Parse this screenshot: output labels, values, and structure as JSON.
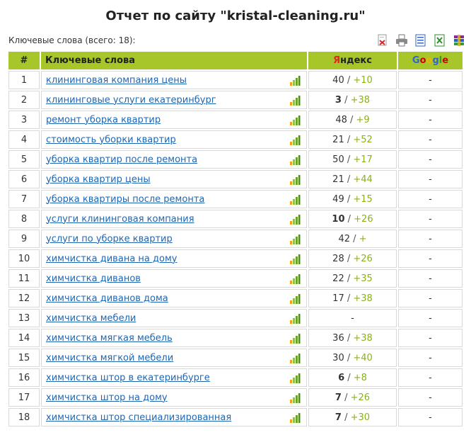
{
  "report": {
    "title": "Отчет по сайту \"kristal-cleaning.ru\"",
    "keywords_count_label": "Ключевые слова (всего: 18):"
  },
  "tools": [
    "pdf-export-icon",
    "print-icon",
    "word-export-icon",
    "excel-export-icon",
    "archive-export-icon"
  ],
  "table": {
    "headers": {
      "num": "#",
      "keyword": "Ключевые слова",
      "yandex_first": "Я",
      "yandex_rest": "ндекс",
      "google": [
        "G",
        "o",
        "o",
        "g",
        "l",
        "e"
      ]
    },
    "rows": [
      {
        "num": "1",
        "keyword": "клининговая компания цены",
        "ya_pos": "40",
        "ya_bold": false,
        "ya_chg": "+10",
        "google": "-"
      },
      {
        "num": "2",
        "keyword": "клининговые услуги екатеринбург",
        "ya_pos": "3",
        "ya_bold": true,
        "ya_chg": "+38",
        "google": "-"
      },
      {
        "num": "3",
        "keyword": "ремонт уборка квартир",
        "ya_pos": "48",
        "ya_bold": false,
        "ya_chg": "+9",
        "google": "-"
      },
      {
        "num": "4",
        "keyword": "стоимость уборки квартир",
        "ya_pos": "21",
        "ya_bold": false,
        "ya_chg": "+52",
        "google": "-"
      },
      {
        "num": "5",
        "keyword": "уборка квартир после ремонта",
        "ya_pos": "50",
        "ya_bold": false,
        "ya_chg": "+17",
        "google": "-"
      },
      {
        "num": "6",
        "keyword": "уборка квартир цены",
        "ya_pos": "21",
        "ya_bold": false,
        "ya_chg": "+44",
        "google": "-"
      },
      {
        "num": "7",
        "keyword": "уборка квартиры после ремонта",
        "ya_pos": "49",
        "ya_bold": false,
        "ya_chg": "+15",
        "google": "-"
      },
      {
        "num": "8",
        "keyword": "услуги клининговая компания",
        "ya_pos": "10",
        "ya_bold": true,
        "ya_chg": "+26",
        "google": "-"
      },
      {
        "num": "9",
        "keyword": "услуги по уборке квартир",
        "ya_pos": "42",
        "ya_bold": false,
        "ya_chg": "+",
        "google": "-"
      },
      {
        "num": "10",
        "keyword": "химчистка дивана на дому",
        "ya_pos": "28",
        "ya_bold": false,
        "ya_chg": "+26",
        "google": "-"
      },
      {
        "num": "11",
        "keyword": "химчистка диванов",
        "ya_pos": "22",
        "ya_bold": false,
        "ya_chg": "+35",
        "google": "-"
      },
      {
        "num": "12",
        "keyword": "химчистка диванов дома",
        "ya_pos": "17",
        "ya_bold": false,
        "ya_chg": "+38",
        "google": "-"
      },
      {
        "num": "13",
        "keyword": "химчистка мебели",
        "ya_pos": "-",
        "ya_bold": false,
        "ya_chg": "",
        "google": "-"
      },
      {
        "num": "14",
        "keyword": "химчистка мягкая мебель",
        "ya_pos": "36",
        "ya_bold": false,
        "ya_chg": "+38",
        "google": "-"
      },
      {
        "num": "15",
        "keyword": "химчистка мягкой мебели",
        "ya_pos": "30",
        "ya_bold": false,
        "ya_chg": "+40",
        "google": "-"
      },
      {
        "num": "16",
        "keyword": "химчистка штор в екатеринбурге",
        "ya_pos": "6",
        "ya_bold": true,
        "ya_chg": "+8",
        "google": "-"
      },
      {
        "num": "17",
        "keyword": "химчистка штор на дому",
        "ya_pos": "7",
        "ya_bold": true,
        "ya_chg": "+26",
        "google": "-"
      },
      {
        "num": "18",
        "keyword": "химчистка штор специализированная",
        "ya_pos": "7",
        "ya_bold": true,
        "ya_chg": "+30",
        "google": "-"
      }
    ]
  },
  "colors": {
    "header_bg": "#a6c629",
    "change_green": "#8bb01a",
    "link_blue": "#1f66b3",
    "google": [
      "#3366cc",
      "#cc0000",
      "#f1b500",
      "#3366cc",
      "#339933",
      "#cc0000"
    ]
  }
}
